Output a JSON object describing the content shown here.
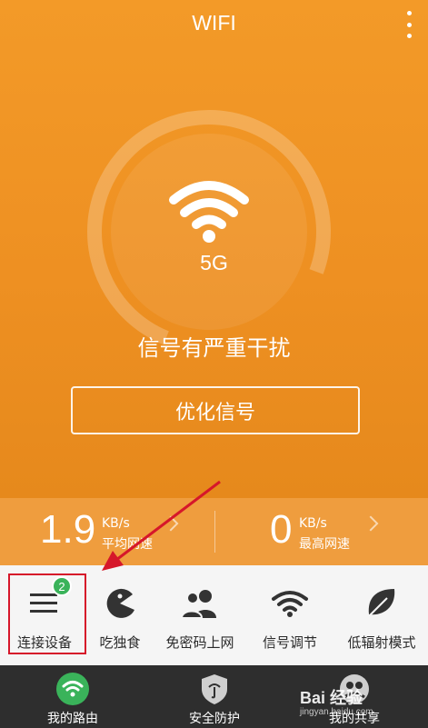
{
  "app": {
    "title": "WIFI"
  },
  "hero": {
    "band": "5G",
    "status": "信号有严重干扰",
    "optimize_label": "优化信号"
  },
  "stats": {
    "average": {
      "value": "1.9",
      "unit": "KB/s",
      "label": "平均网速"
    },
    "peak": {
      "value": "0",
      "unit": "KB/s",
      "label": "最高网速"
    }
  },
  "tools": [
    {
      "label": "连接设备",
      "icon": "device-list-icon",
      "badge": "2"
    },
    {
      "label": "吃独食",
      "icon": "pacman-icon"
    },
    {
      "label": "免密码上网",
      "icon": "users-icon"
    },
    {
      "label": "信号调节",
      "icon": "wifi-signal-icon"
    },
    {
      "label": "低辐射模式",
      "icon": "leaf-icon"
    }
  ],
  "bottom_nav": [
    {
      "label": "我的路由",
      "icon": "wifi-router-icon"
    },
    {
      "label": "安全防护",
      "icon": "shield-icon"
    },
    {
      "label": "我的共享",
      "icon": "share-icon"
    }
  ],
  "watermark": {
    "text": "Bai 经验",
    "sub": "jingyan.baidu.com"
  },
  "colors": {
    "accent": "#F0921F",
    "badge": "#3AB35A",
    "highlight": "#D6172A"
  }
}
